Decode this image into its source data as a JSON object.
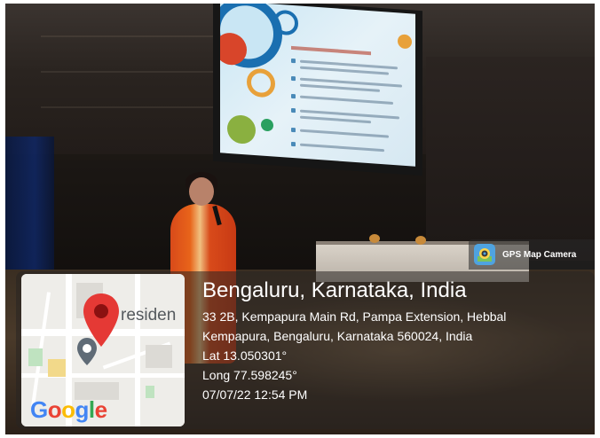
{
  "overlay": {
    "app_label": "GPS Map Camera",
    "location_title": "Bengaluru, Karnataka, India",
    "address_line1": "33 2B, Kempapura Main Rd, Pampa Extension, Hebbal",
    "address_line2": "Kempapura, Bengaluru, Karnataka 560024, India",
    "lat": "Lat 13.050301°",
    "long": "Long 77.598245°",
    "datetime": "07/07/22 12:54 PM"
  },
  "map": {
    "partial_label": "residen",
    "logo_text": "Google",
    "logo_letters": [
      {
        "char": "G",
        "color": "#4285F4"
      },
      {
        "char": "o",
        "color": "#EA4335"
      },
      {
        "char": "o",
        "color": "#FBBC05"
      },
      {
        "char": "g",
        "color": "#4285F4"
      },
      {
        "char": "l",
        "color": "#34A853"
      },
      {
        "char": "e",
        "color": "#EA4335"
      }
    ],
    "pin_color": "#E53935"
  },
  "scene": {
    "screen_accent_colors": [
      "#1a6fb0",
      "#e8a13a",
      "#2aa060",
      "#d8452a"
    ]
  }
}
